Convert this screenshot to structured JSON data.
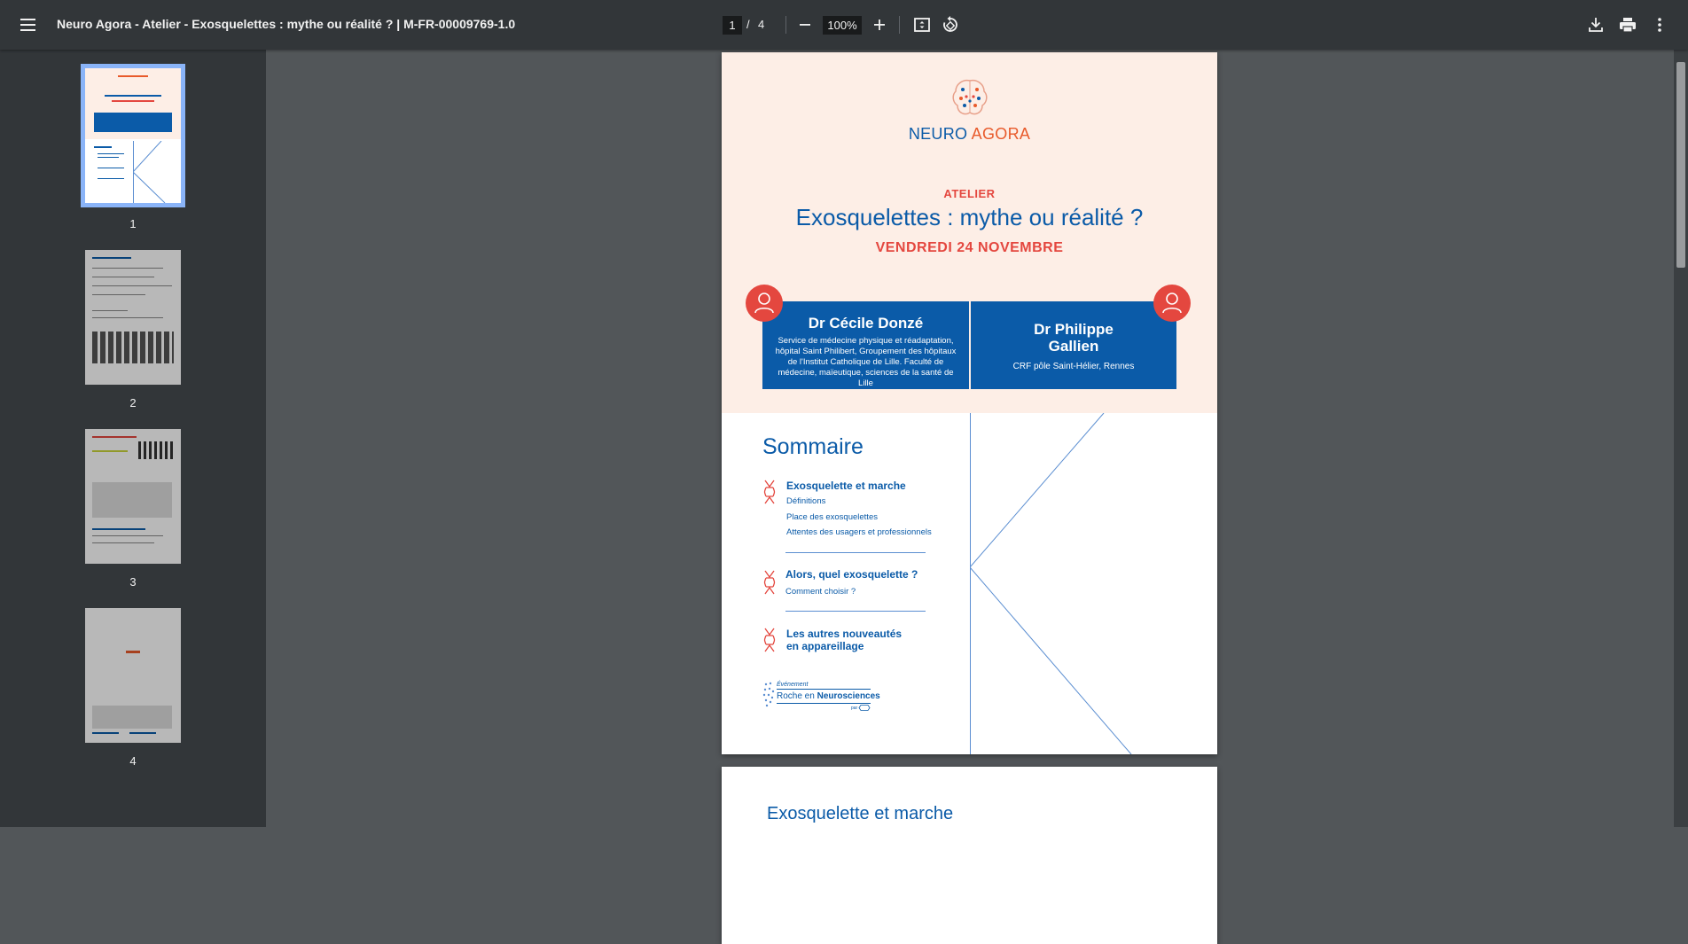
{
  "toolbar": {
    "title": "Neuro Agora - Atelier - Exosquelettes : mythe ou réalité ? | M-FR-00009769-1.0",
    "current_page": "1",
    "page_separator": "/",
    "total_pages": "4",
    "zoom": "100%"
  },
  "sidebar": {
    "thumbnails": [
      {
        "label": "1",
        "active": true
      },
      {
        "label": "2",
        "active": false
      },
      {
        "label": "3",
        "active": false
      },
      {
        "label": "4",
        "active": false
      }
    ]
  },
  "page1": {
    "logo_neuro": "NEURO",
    "logo_agora": "AGORA",
    "kicker": "ATELIER",
    "title": "Exosquelettes : mythe ou réalité ?",
    "date": "VENDREDI 24 NOVEMBRE",
    "speaker1": {
      "name": "Dr Cécile Donzé",
      "affiliation": "Service de médecine physique et réadaptation, hôpital Saint Philibert, Groupement des hôpitaux de l'Institut Catholique de Lille. Faculté de médecine, maïeutique, sciences de la santé de Lille"
    },
    "speaker2": {
      "name_line1": "Dr Philippe",
      "name_line2": "Gallien",
      "affiliation": "CRF pôle Saint-Hélier, Rennes"
    },
    "sommaire_title": "Sommaire",
    "toc": [
      {
        "heading": "Exosquelette et marche",
        "items": [
          "Définitions",
          "Place des exosquelettes",
          "Attentes des usagers et professionnels"
        ]
      },
      {
        "heading": "Alors, quel exosquelette ?",
        "items": [
          "Comment choisir ?"
        ]
      },
      {
        "heading_line1": "Les autres nouveautés",
        "heading_line2": "en appareillage"
      }
    ],
    "roche": {
      "evenement": "Événement",
      "roche_en": "Roche en",
      "neurosciences": "Neurosciences",
      "par": "par"
    }
  },
  "page2": {
    "heading": "Exosquelette et marche"
  },
  "colors": {
    "toolbar_bg": "#323639",
    "viewer_bg": "#525659",
    "brand_blue": "#0b5ba8",
    "brand_red": "#e4473f",
    "hero_bg": "#fdeee6",
    "active_thumb_outline": "#8ab4f8"
  },
  "icons": [
    "menu-icon",
    "zoom-out-icon",
    "zoom-in-icon",
    "fit-page-icon",
    "rotate-icon",
    "download-icon",
    "print-icon",
    "more-vert-icon",
    "person-icon",
    "joint-icon"
  ]
}
